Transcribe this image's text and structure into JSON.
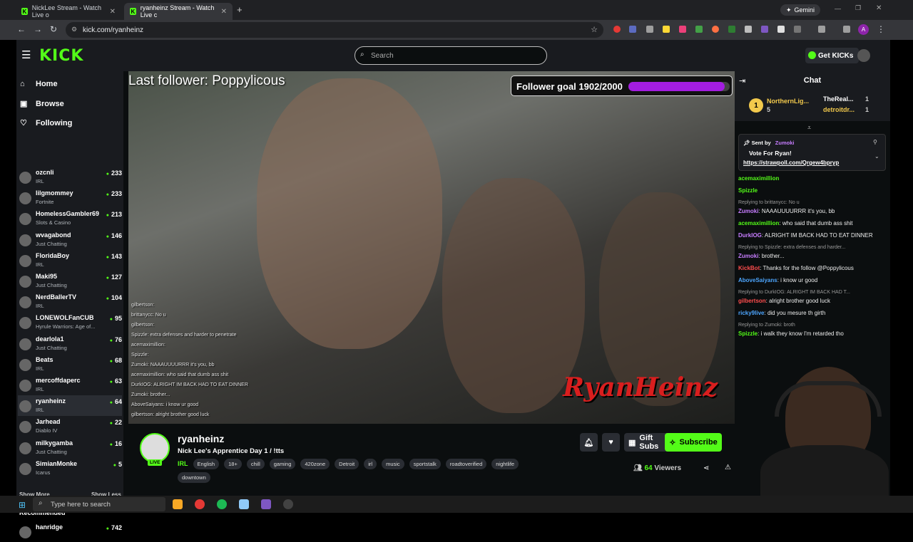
{
  "browser": {
    "tabs": [
      {
        "title": "NickLee Stream - Watch Live o",
        "active": false
      },
      {
        "title": "ryanheinz Stream - Watch Live c",
        "active": true
      }
    ],
    "new_tab": "+",
    "gemini": "Gemini",
    "url": "kick.com/ryanheinz",
    "profile_initial": "A"
  },
  "kick": {
    "logo": "KICK",
    "search_placeholder": "Search",
    "get_kicks": "Get KICKs"
  },
  "sidebar": {
    "nav": [
      {
        "label": "Home",
        "icon": "home-icon"
      },
      {
        "label": "Browse",
        "icon": "browse-icon"
      },
      {
        "label": "Following",
        "icon": "heart-icon"
      }
    ],
    "channels": [
      {
        "name": "ozcnli",
        "category": "IRL",
        "viewers": "233"
      },
      {
        "name": "lilgmommey",
        "category": "Fortnite",
        "viewers": "233"
      },
      {
        "name": "HomelessGambler69",
        "category": "Slots & Casino",
        "viewers": "213"
      },
      {
        "name": "wvagabond",
        "category": "Just Chatting",
        "viewers": "146"
      },
      {
        "name": "FloridaBoy",
        "category": "IRL",
        "viewers": "143"
      },
      {
        "name": "Maki95",
        "category": "Just Chatting",
        "viewers": "127"
      },
      {
        "name": "NerdBallerTV",
        "category": "IRL",
        "viewers": "104"
      },
      {
        "name": "LONEWOLFanCUB",
        "category": "Hyrule Warriors: Age of...",
        "viewers": "95"
      },
      {
        "name": "dearlola1",
        "category": "Just Chatting",
        "viewers": "76"
      },
      {
        "name": "Beats",
        "category": "IRL",
        "viewers": "68"
      },
      {
        "name": "mercoffdaperc",
        "category": "IRL",
        "viewers": "63"
      },
      {
        "name": "ryanheinz",
        "category": "IRL",
        "viewers": "64"
      },
      {
        "name": "Jarhead",
        "category": "Diablo IV",
        "viewers": "22"
      },
      {
        "name": "milkygamba",
        "category": "Just Chatting",
        "viewers": "16"
      },
      {
        "name": "SimianMonke",
        "category": "Icarus",
        "viewers": "5"
      }
    ],
    "show_more": "Show More",
    "show_less": "Show Less",
    "recommended_heading": "Recommended",
    "recommended": [
      {
        "name": "hanridge",
        "viewers": "742"
      }
    ]
  },
  "video": {
    "last_follower": "Last follower: Poppylicous",
    "goal_label": "Follower goal 1902/2000",
    "goal_progress": 0.951,
    "watermark": "RyanHeinz",
    "overlay_chat": [
      "gilbertson:",
      "brittanycc: No u",
      "gilbertson:",
      "Spizzle: extra defenses and harder to penetrate",
      "acemaximillion:",
      "Spizzle:",
      "Zumoki: NAAAUUUURRR it's you, bb",
      "acemaximillion: who said that dumb ass shit",
      "DurkIOG: ALRIGHT IM BACK HAD TO EAT DINNER",
      "Zumoki: brother...",
      "AboveSaiyans: i know ur good",
      "gilbertson: alright brother good luck"
    ]
  },
  "stream": {
    "name": "ryanheinz",
    "live": "LIVE",
    "title": "Nick Lee's Apprentice Day 1 / !tts",
    "category": "IRL",
    "tags": [
      "English",
      "18+",
      "chill",
      "gaming",
      "420zone",
      "Detroit",
      "irl",
      "music",
      "sportstalk",
      "roadtoverified",
      "nightlife",
      "downtown"
    ],
    "gift_subs": "Gift Subs",
    "subscribe": "Subscribe",
    "viewer_count": "64",
    "viewers_label": "Viewers"
  },
  "chat": {
    "title": "Chat",
    "gifters": [
      {
        "rank": "1",
        "name": "NorthernLig...",
        "count": "5"
      },
      {
        "name": "TheReal...",
        "count": "1"
      },
      {
        "name": "detroitdr...",
        "count": "1"
      }
    ],
    "pinned": {
      "sent_by_label": "Sent by",
      "sender": "Zumoki",
      "text": "Vote For Ryan!",
      "link": "https://strawpoll.com/Qrgew4bpryp"
    },
    "messages": [
      {
        "reply": "",
        "user": "acemaximillion",
        "color": "#53fc18",
        "text": ""
      },
      {
        "reply": "",
        "user": "Spizzle",
        "color": "#53fc18",
        "text": ""
      },
      {
        "reply": "Replying to brittanycc: No u",
        "user": "Zumoki",
        "color": "#c77dff",
        "text": "NAAAUUUURRR it's you, bb"
      },
      {
        "reply": "",
        "user": "acemaximillion",
        "color": "#53fc18",
        "text": "who said that dumb ass shit"
      },
      {
        "reply": "",
        "user": "DurkIOG",
        "color": "#c77dff",
        "text": "ALRIGHT IM BACK HAD TO EAT DINNER"
      },
      {
        "reply": "Replying to Spizzle: extra defenses and harder...",
        "user": "Zumoki",
        "color": "#c77dff",
        "text": "brother..."
      },
      {
        "reply": "",
        "user": "KickBot",
        "color": "#ff4d4d",
        "text": "Thanks for the follow @Poppylicous"
      },
      {
        "reply": "",
        "user": "AboveSaiyans",
        "color": "#4da6ff",
        "text": "i know ur good"
      },
      {
        "reply": "Replying to DurkIOG: ALRIGHT IM BACK HAD T...",
        "user": "gilbertson",
        "color": "#ff4d4d",
        "text": "alright brother good luck"
      },
      {
        "reply": "",
        "user": "ricky9live",
        "color": "#4da6ff",
        "text": "did you mesure th girth"
      },
      {
        "reply": "Replying to Zumoki: broth",
        "user": "Spizzle",
        "color": "#53fc18",
        "text": "i walk they know I'm retarded tho"
      }
    ]
  },
  "taskbar": {
    "search_placeholder": "Type here to search"
  },
  "colors": {
    "kick_green": "#53fc18",
    "goal_purple": "#a31de0",
    "panel": "#191b1f",
    "background": "#0b0e0f"
  }
}
